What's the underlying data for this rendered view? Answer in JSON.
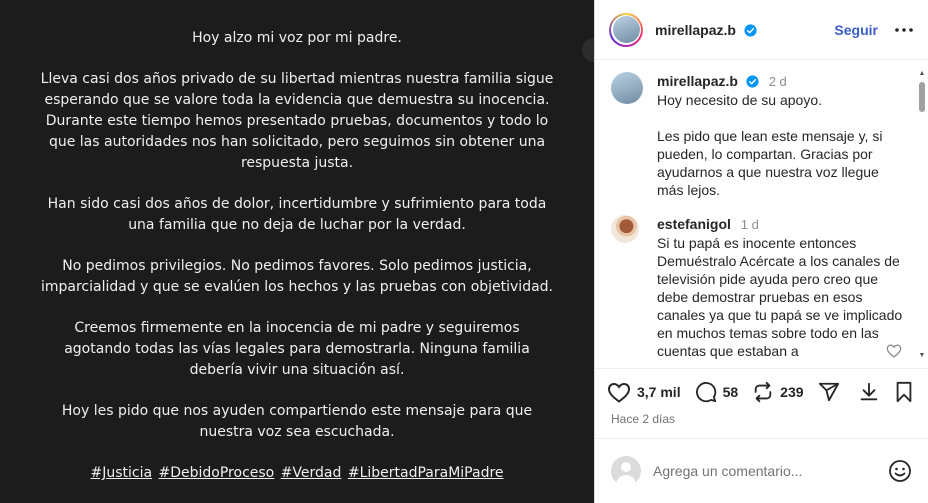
{
  "post": {
    "paragraphs": [
      "Hoy alzo mi voz por mi padre.",
      "Lleva casi dos años privado de su libertad mientras nuestra familia sigue esperando que se valore toda la evidencia que demuestra su inocencia. Durante este tiempo hemos presentado pruebas, documentos y todo lo que las autoridades nos han solicitado, pero seguimos sin obtener una respuesta justa.",
      "Han sido casi dos años de dolor, incertidumbre y sufrimiento para toda una familia que no deja de luchar por la verdad.",
      "No pedimos privilegios. No pedimos favores. Solo pedimos justicia, imparcialidad y que se evalúen los hechos y las pruebas con objetividad.",
      "Creemos firmemente en la inocencia de mi padre y seguiremos agotando todas las vías legales para demostrarla. Ninguna familia debería vivir una situación así.",
      "Hoy les pido que nos ayuden compartiendo este mensaje para que nuestra voz sea escuchada."
    ],
    "hashtags": [
      "#Justicia",
      "#DebidoProceso",
      "#Verdad",
      "#LibertadParaMiPadre"
    ]
  },
  "header": {
    "username": "mirellapaz.b",
    "follow_label": "Seguir"
  },
  "comments": [
    {
      "username": "mirellapaz.b",
      "time": "2 d",
      "text": "Hoy necesito de su apoyo.\n\nLes pido que lean este mensaje y, si pueden, lo compartan. Gracias por ayudarnos a que nuestra voz llegue más lejos."
    },
    {
      "username": "estefanigol",
      "time": "1 d",
      "text": "Si tu papá es inocente entonces Demuéstralo Acércate a los canales de televisión pide ayuda pero creo que debe demostrar pruebas en esos canales ya que tu papá se ve implicado en muchos temas sobre todo en las cuentas que estaban a"
    }
  ],
  "actions": {
    "likes": "3,7 mil",
    "comments": "58",
    "reposts": "239"
  },
  "timestamp": "Hace 2 días",
  "add_comment": {
    "placeholder": "Agrega un comentario..."
  },
  "colors": {
    "image_bg": "#1c1c1c",
    "follow": "#3b5ec6",
    "verified": "#0095f6"
  }
}
